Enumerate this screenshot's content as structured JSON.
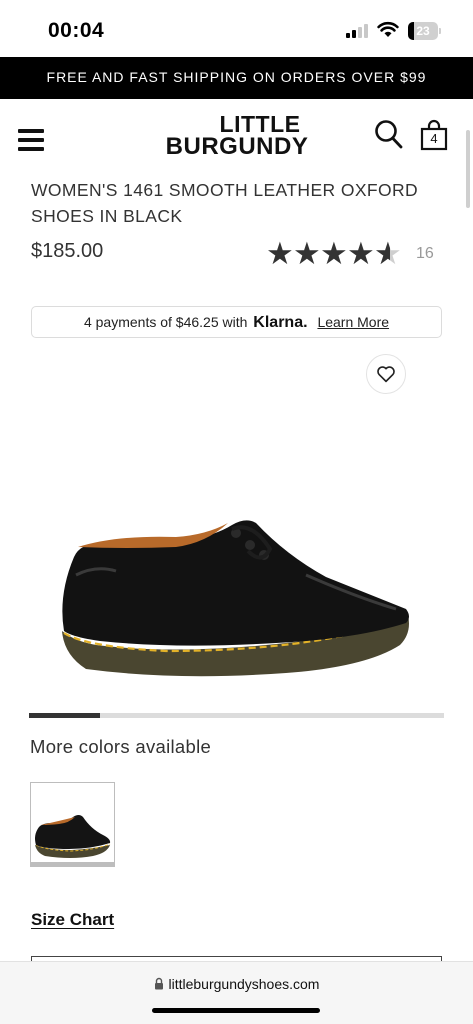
{
  "status_bar": {
    "time": "00:04",
    "battery": "23"
  },
  "promo": {
    "text": "FREE AND FAST SHIPPING ON ORDERS OVER $99"
  },
  "header": {
    "logo_line1": "LITTLE",
    "logo_line2": "BURGUNDY",
    "cart_count": "4"
  },
  "product": {
    "title": "WOMEN'S 1461 SMOOTH LEATHER OXFORD SHOES IN BLACK",
    "price": "$185.00",
    "rating": 4.6,
    "review_count": "16"
  },
  "klarna": {
    "prefix": "4 payments of $46.25 with",
    "brand": "Klarna.",
    "link": "Learn More"
  },
  "gallery": {
    "progress": 0.17
  },
  "more_colors": {
    "heading": "More colors available"
  },
  "size_chart": {
    "label": "Size Chart"
  },
  "browser": {
    "url": "littleburgundyshoes.com"
  },
  "icons": [
    "menu-icon",
    "search-icon",
    "cart-icon",
    "heart-icon",
    "lock-icon",
    "wifi-icon",
    "star-icon"
  ],
  "colors": {
    "promo_bg": "#000000",
    "text": "#333333",
    "star": "#333333",
    "klarna_border": "#dcdcdc"
  }
}
